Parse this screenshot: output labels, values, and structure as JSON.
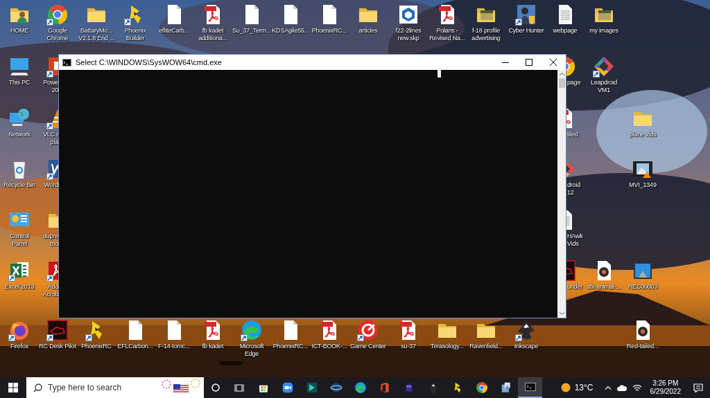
{
  "desktop": {
    "icons": [
      {
        "label": "HOME",
        "kind": "user-folder",
        "shortcut": false
      },
      {
        "label": "Google\nChrome",
        "kind": "chrome",
        "shortcut": true
      },
      {
        "label": "BattaryMo...\nV2.1.8 End ...",
        "kind": "folder",
        "shortcut": false
      },
      {
        "label": "Phoenix\nBuilder",
        "kind": "plane",
        "shortcut": true
      },
      {
        "label": "efliteCarb...",
        "kind": "file",
        "shortcut": false
      },
      {
        "label": "fb kadet\nadditiona...",
        "kind": "pdf",
        "shortcut": false
      },
      {
        "label": "Su_37_Term...",
        "kind": "file",
        "shortcut": false
      },
      {
        "label": "KDSAgile55...",
        "kind": "file",
        "shortcut": false
      },
      {
        "label": "PhoenixRC...",
        "kind": "file",
        "shortcut": false
      },
      {
        "label": "articles",
        "kind": "folder",
        "shortcut": false
      },
      {
        "label": "f22-2lines\nnew.skp",
        "kind": "cube",
        "shortcut": false
      },
      {
        "label": "Polaris -\nRevised Na...",
        "kind": "pdf",
        "shortcut": false
      },
      {
        "label": "f-18 profile\nadvertising",
        "kind": "image-folder",
        "shortcut": false
      },
      {
        "label": "Cyber Hunter",
        "kind": "game",
        "shortcut": true
      },
      {
        "label": "webpage",
        "kind": "doc",
        "shortcut": false
      },
      {
        "label": "my images",
        "kind": "image-folder",
        "shortcut": false
      },
      {
        "label": "This PC",
        "kind": "pc",
        "shortcut": false
      },
      {
        "label": "Network",
        "kind": "network",
        "shortcut": false
      },
      {
        "label": "Recycle Bin",
        "kind": "recycle",
        "shortcut": false
      },
      {
        "label": "Control\nPanel",
        "kind": "control",
        "shortcut": false
      },
      {
        "label": "Excel 2013",
        "kind": "excel",
        "shortcut": true
      },
      {
        "label": "Powe\n20",
        "kind": "powerpoint",
        "shortcut": true
      },
      {
        "label": "VLC r\npla",
        "kind": "cone",
        "shortcut": true
      },
      {
        "label": "Word",
        "kind": "word",
        "shortcut": true
      },
      {
        "label": "dupre\nmo",
        "kind": "folder",
        "shortcut": false
      },
      {
        "label": "Ado\nAcrob",
        "kind": "acrobat",
        "shortcut": true
      },
      {
        "label": "Firefox",
        "kind": "firefox",
        "shortcut": true
      },
      {
        "label": "RC Desk Pilot",
        "kind": "rcdesk",
        "shortcut": true
      },
      {
        "label": "PhoenixRC",
        "kind": "plane",
        "shortcut": true
      },
      {
        "label": "EFLCarbon...",
        "kind": "file",
        "shortcut": false
      },
      {
        "label": "F-14-tomc...",
        "kind": "file",
        "shortcut": false
      },
      {
        "label": "fb kadet",
        "kind": "pdf",
        "shortcut": false
      },
      {
        "label": "Microsoft\nEdge",
        "kind": "edge",
        "shortcut": true
      },
      {
        "label": "PhoenixRC...",
        "kind": "file",
        "shortcut": false
      },
      {
        "label": "ICT-BOOK-...",
        "kind": "pdf",
        "shortcut": false
      },
      {
        "label": "Game Center",
        "kind": "gamecenter",
        "shortcut": true
      },
      {
        "label": "su-37",
        "kind": "pdf",
        "shortcut": false
      },
      {
        "label": "Terasology...",
        "kind": "folder",
        "shortcut": false
      },
      {
        "label": "Ravenfield...",
        "kind": "folder",
        "shortcut": false
      },
      {
        "label": "Inkscape",
        "kind": "inkscape",
        "shortcut": true
      },
      {
        "label": "Red-tailed...",
        "kind": "audio",
        "shortcut": false
      },
      {
        "label": "page",
        "kind": "chrome"
      },
      {
        "label": "tiled",
        "kind": "pdf"
      },
      {
        "label": "droid\n12",
        "kind": "leapdroid"
      },
      {
        "label": "HAwk\nVids",
        "kind": "doc"
      },
      {
        "label": "under",
        "kind": "rcdesk"
      },
      {
        "label": "Leapdroid\nVM1",
        "kind": "leapdroid",
        "shortcut": true
      },
      {
        "label": "plane vids",
        "kind": "folder",
        "shortcut": false
      },
      {
        "label": "MVI_1349",
        "kind": "video",
        "shortcut": false
      },
      {
        "label": "sfx-animal-...",
        "kind": "audio",
        "shortcut": false
      },
      {
        "label": "REC00003",
        "shortcut": false
      }
    ]
  },
  "window": {
    "title": "Select C:\\WINDOWS\\SysWOW64\\cmd.exe"
  },
  "taskbar": {
    "search": {
      "placeholder": "Type here to search"
    },
    "apps": [
      {
        "kind": "store",
        "active": false
      },
      {
        "kind": "zoom",
        "active": false
      },
      {
        "kind": "filmora",
        "active": false
      },
      {
        "kind": "globe",
        "active": false
      },
      {
        "kind": "edge",
        "active": false
      },
      {
        "kind": "office",
        "active": false
      },
      {
        "kind": "ghost",
        "active": false
      },
      {
        "kind": "inkscape",
        "active": false
      },
      {
        "kind": "plane",
        "active": false
      },
      {
        "kind": "chrome",
        "active": false
      },
      {
        "kind": "installer",
        "active": false
      },
      {
        "kind": "terminal",
        "active": true
      }
    ],
    "weather": "13°C",
    "time": "3:26 PM",
    "date": "6/29/2022"
  }
}
